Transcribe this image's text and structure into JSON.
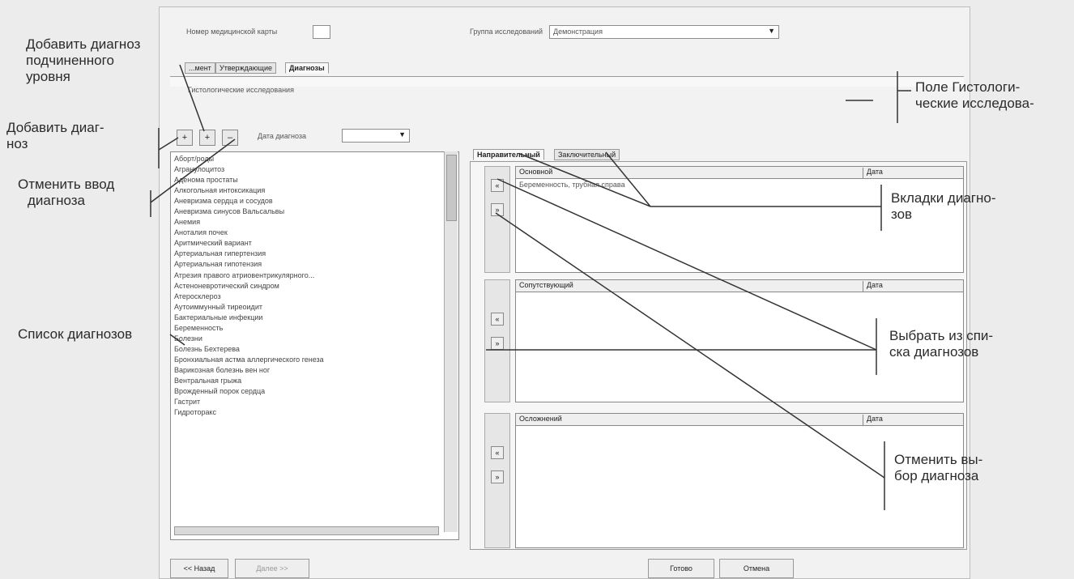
{
  "form": {
    "card_label": "Номер медицинской карты",
    "group_label": "Группа исследований",
    "group_value": "Демонстрация",
    "tabs": [
      "...мент",
      "Утверждающие",
      "Диагнозы"
    ],
    "histology_field": "Гистологические исследования",
    "date_label": "Дата диагноза"
  },
  "toolbar": {
    "add": "+",
    "add_sub": "+",
    "cancel": "–"
  },
  "diagnosis_list": [
    "Аборт/роды",
    "Агранулоцитоз",
    "Аденома простаты",
    "Алкогольная интоксикация",
    "Аневризма сердца и сосудов",
    "Аневризма синусов Вальсальвы",
    "Анемия",
    "Аноталия почек",
    "Аритмический вариант",
    "Артериальная гипертензия",
    "Артериальная гипотензия",
    "Атрезия правого атриовентрикулярного...",
    "Астеноневротический синдром",
    "Атеросклероз",
    "Аутоиммунный тиреоидит",
    "Бактериальные инфекции",
    "Беременность",
    "Болезни",
    "Болезнь Бехтерева",
    "Бронхиальная астма аллергического генеза",
    "Варикозная болезнь вен ног",
    "Вентральная грыжа",
    "Врожденный порок сердца",
    "Гастрит",
    "Гидроторакс"
  ],
  "right_tabs": [
    "Направительный",
    "Заключительный"
  ],
  "panels": [
    {
      "title": "Основной",
      "date_col": "Дата",
      "rows": [
        "Беременность, трубная справа"
      ]
    },
    {
      "title": "Сопутствующий",
      "date_col": "Дата",
      "rows": []
    },
    {
      "title": "Осложнений",
      "date_col": "Дата",
      "rows": []
    }
  ],
  "bottom": {
    "back": "<< Назад",
    "next": "Далее >>",
    "ok": "Готово",
    "cancel": "Отмена"
  },
  "callouts": {
    "add_sub_1": "Добавить диагноз",
    "add_sub_2": "подчиненного",
    "add_sub_3": "уровня",
    "add_1": "Добавить диаг-",
    "add_2": "ноз",
    "cancel_1": "Отменить ввод",
    "cancel_2": "диагноза",
    "list": "Список диагнозов",
    "histology_1": "Поле Гистологи-",
    "histology_2": "ческие исследова-",
    "tabs_1": "Вкладки диагно-",
    "tabs_2": "зов",
    "choose_1": "Выбрать из спи-",
    "choose_2": "ска диагнозов",
    "cancel_choice_1": "Отменить вы-",
    "cancel_choice_2": "бор диагноза"
  }
}
